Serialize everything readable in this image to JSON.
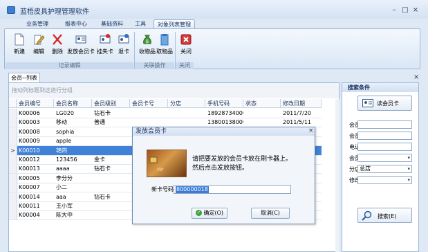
{
  "window": {
    "title": "蓝梧皮具护理管理软件",
    "controls": [
      "–",
      "□",
      "×"
    ]
  },
  "menu_tabs": [
    "业务管理",
    "报表中心",
    "基础资料",
    "工具",
    "对象列表管理"
  ],
  "ribbon": {
    "groups": [
      {
        "caption": "记录编辑",
        "buttons": [
          "新建",
          "编辑",
          "删除",
          "发放会员卡",
          "挂失卡",
          "退卡"
        ]
      },
      {
        "caption": "关联操作",
        "buttons": [
          "收物品",
          "取物品"
        ]
      },
      {
        "caption": "关闭",
        "buttons": [
          "关闭"
        ]
      }
    ]
  },
  "doc_tab": {
    "label": "会员--列表",
    "close": "×"
  },
  "grid": {
    "group_hint": "拖动列标题到这进行分组",
    "columns": [
      "会员编号",
      "会员名称",
      "会员级别",
      "会员卡号",
      "分店",
      "手机号码",
      "状态",
      "修改日期"
    ],
    "rows": [
      [
        "K00006",
        "LG020",
        "钻石卡",
        "",
        "",
        "18928734000",
        "",
        "2011/7/20"
      ],
      [
        "K00003",
        "移动",
        "普通",
        "",
        "",
        "13800138000",
        "",
        "2011/5/11"
      ],
      [
        "K00008",
        "sophia",
        "",
        "",
        "",
        "",
        "",
        ""
      ],
      [
        "K00009",
        "apple",
        "",
        "",
        "",
        "",
        "",
        ""
      ],
      [
        "K00010",
        "艳四",
        "",
        "",
        "",
        "",
        "",
        ""
      ],
      [
        "K00012",
        "123456",
        "金卡",
        "",
        "",
        "",
        "",
        ""
      ],
      [
        "K00013",
        "aaaa",
        "钻石卡",
        "",
        "",
        "",
        "",
        ""
      ],
      [
        "K00005",
        "李分分",
        "",
        "",
        "",
        "",
        "",
        ""
      ],
      [
        "K00007",
        "小二",
        "",
        "",
        "",
        "",
        "",
        ""
      ],
      [
        "K00014",
        "aaa",
        "钻石卡",
        "",
        "",
        "",
        "",
        ""
      ],
      [
        "K00011",
        "王小军",
        "",
        "",
        "",
        "",
        "",
        ""
      ],
      [
        "K00004",
        "陈大中",
        "",
        "",
        "",
        "",
        "",
        ""
      ]
    ],
    "selected_row": 4,
    "selected_indicator": ">"
  },
  "search_panel": {
    "caption": "搜索条件",
    "read_card_button": "读会员卡",
    "fields": [
      {
        "label": "会员编号:",
        "value": ""
      },
      {
        "label": "会员名称:",
        "value": ""
      },
      {
        "label": "电话号码:",
        "value": ""
      },
      {
        "label": "会员级别:",
        "value": ""
      },
      {
        "label": "分店:",
        "value": "总店"
      },
      {
        "label": "修改人:",
        "value": ""
      }
    ],
    "search_button": "搜索(E)"
  },
  "dialog": {
    "title": "发放会员卡",
    "close": "×",
    "message_line1": "请把要发放的会员卡放在刷卡器上。",
    "message_line2": "然后点击发放按钮。",
    "card_label": "新卡号码:",
    "card_value": "800000018",
    "ok_button": "确定(O)",
    "cancel_button": "取消(C)"
  },
  "colors": {
    "selection": "#3f82d8",
    "accent": "#1e3560"
  }
}
